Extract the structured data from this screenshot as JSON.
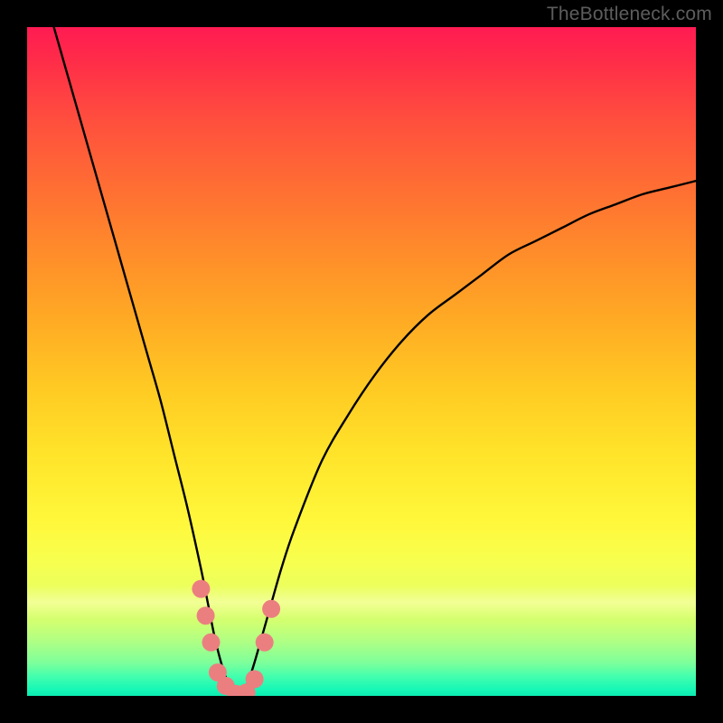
{
  "watermark": "TheBottleneck.com",
  "chart_data": {
    "type": "line",
    "title": "",
    "xlabel": "",
    "ylabel": "",
    "xlim": [
      0,
      100
    ],
    "ylim": [
      0,
      100
    ],
    "grid": false,
    "series": [
      {
        "name": "bottleneck-curve",
        "x": [
          4,
          6,
          8,
          10,
          12,
          14,
          16,
          18,
          20,
          22,
          24,
          26,
          27,
          28,
          29,
          30,
          31,
          32,
          33,
          34,
          36,
          38,
          40,
          44,
          48,
          52,
          56,
          60,
          64,
          68,
          72,
          76,
          80,
          84,
          88,
          92,
          96,
          100
        ],
        "values": [
          100,
          93,
          86,
          79,
          72,
          65,
          58,
          51,
          44,
          36,
          28,
          19,
          14,
          9,
          5,
          2,
          0,
          0,
          2,
          5,
          12,
          19,
          25,
          35,
          42,
          48,
          53,
          57,
          60,
          63,
          66,
          68,
          70,
          72,
          73.5,
          75,
          76,
          77
        ]
      }
    ],
    "markers": [
      {
        "name": "dot-left-upper",
        "x": 26.0,
        "y": 16
      },
      {
        "name": "dot-left-mid",
        "x": 26.7,
        "y": 12
      },
      {
        "name": "dot-left-lower",
        "x": 27.5,
        "y": 8
      },
      {
        "name": "dot-base-1",
        "x": 28.5,
        "y": 3.5
      },
      {
        "name": "dot-base-2",
        "x": 29.7,
        "y": 1.5
      },
      {
        "name": "dot-base-3",
        "x": 31.2,
        "y": 0.3
      },
      {
        "name": "dot-base-4",
        "x": 32.8,
        "y": 0.5
      },
      {
        "name": "dot-base-5",
        "x": 34.0,
        "y": 2.5
      },
      {
        "name": "dot-right-lower",
        "x": 35.5,
        "y": 8
      },
      {
        "name": "dot-right-upper",
        "x": 36.5,
        "y": 13
      }
    ],
    "colors": {
      "curve": "#000000",
      "marker": "#eb7f80",
      "gradient_top": "#ff1b52",
      "gradient_mid": "#ffe42a",
      "gradient_bottom": "#0cecb2"
    }
  }
}
